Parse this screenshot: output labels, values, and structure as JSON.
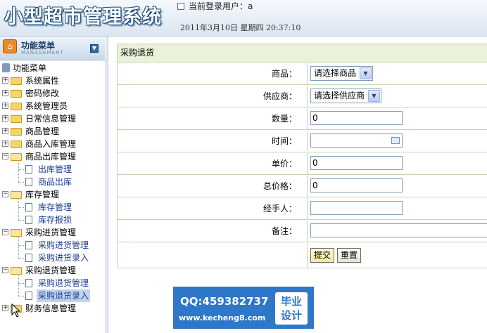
{
  "header": {
    "title": "小型超市管理系统",
    "current_user_label": "当前登录用户：a",
    "datetime": "2011年3月10日  星期四  20:37:10"
  },
  "sidebar": {
    "menu_title": "功能菜单",
    "menu_subtitle": "MANAGEMENT",
    "root_label": "功能菜单",
    "nodes": [
      {
        "label": "系统属性",
        "expanded": false
      },
      {
        "label": "密码修改",
        "expanded": false
      },
      {
        "label": "系统管理员",
        "expanded": false
      },
      {
        "label": "日常信息管理",
        "expanded": false
      },
      {
        "label": "商品管理",
        "expanded": false
      },
      {
        "label": "商品入库管理",
        "expanded": false
      },
      {
        "label": "商品出库管理",
        "expanded": true,
        "children": [
          "出库管理",
          "商品出库"
        ]
      },
      {
        "label": "库存管理",
        "expanded": true,
        "children": [
          "库存管理",
          "库存报损"
        ]
      },
      {
        "label": "采购进货管理",
        "expanded": true,
        "children": [
          "采购进货管理",
          "采购进货录入"
        ]
      },
      {
        "label": "采购退货管理",
        "expanded": true,
        "children": [
          "采购退货管理",
          "采购退货录入"
        ],
        "selected_child": 1
      },
      {
        "label": "财务信息管理",
        "expanded": false
      }
    ]
  },
  "form": {
    "title": "采购退货",
    "fields": {
      "product_label": "商品：",
      "product_value": "请选择商品",
      "supplier_label": "供应商：",
      "supplier_value": "请选择供应商",
      "quantity_label": "数量：",
      "quantity_value": "0",
      "time_label": "时间：",
      "time_value": "",
      "unit_price_label": "单价：",
      "unit_price_value": "0",
      "total_price_label": "总价格：",
      "total_price_value": "0",
      "handler_label": "经手人：",
      "handler_value": "",
      "remark_label": "备注：",
      "remark_value": ""
    },
    "submit_label": "提交",
    "reset_label": "重置"
  },
  "watermark": {
    "qq": "QQ:459382737",
    "site": "www.kecheng8.com",
    "badge_line1": "毕业",
    "badge_line2": "设计"
  },
  "colors": {
    "form_border": "#c9d3b6",
    "form_header_bg": "#eaf2d7",
    "watermark_bg": "#2f77c8"
  }
}
